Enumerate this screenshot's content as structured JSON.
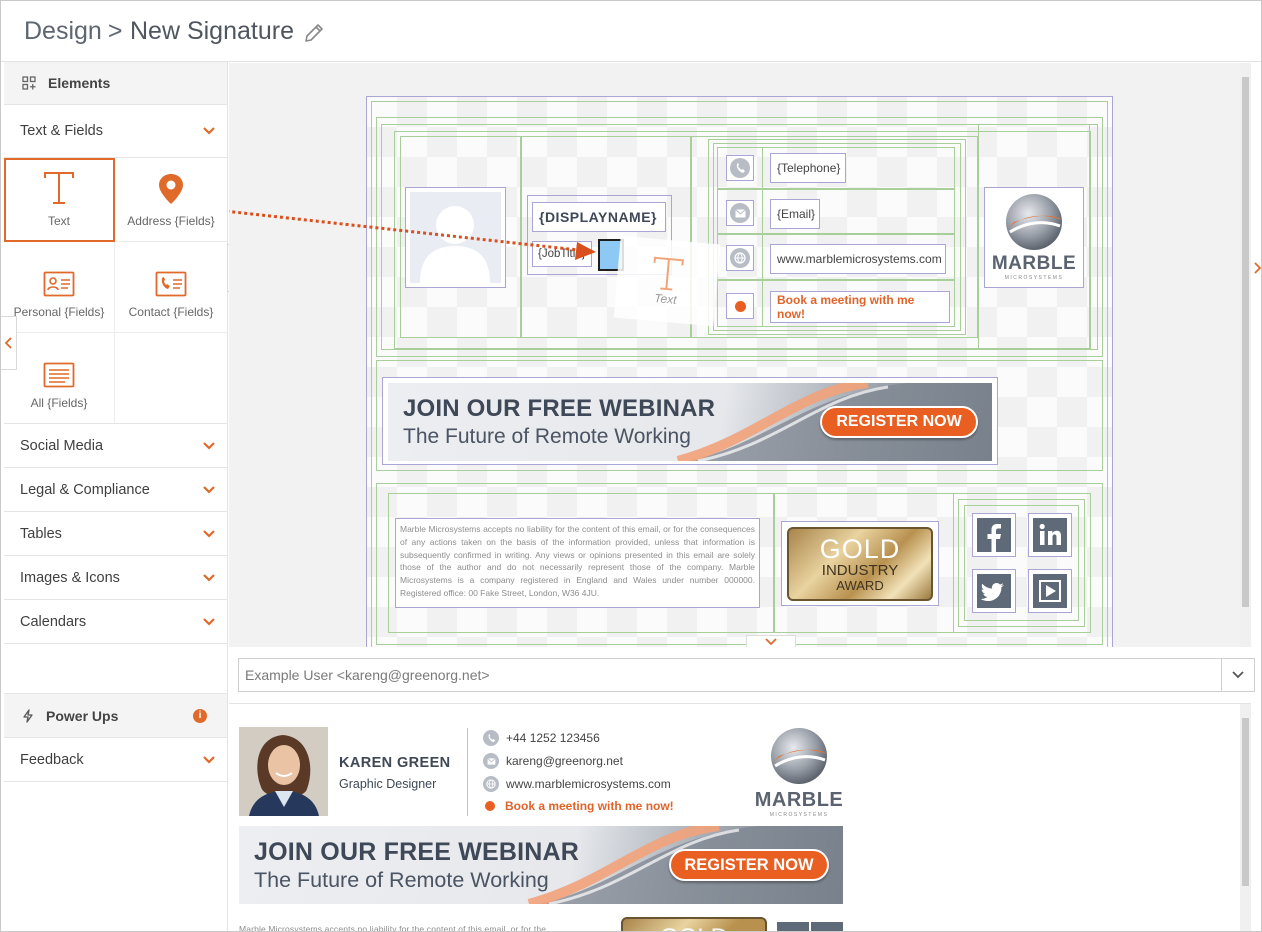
{
  "header": {
    "breadcrumb": "Design",
    "separator": ">",
    "title": "New Signature"
  },
  "sidebar": {
    "elements_header": "Elements",
    "text_fields_label": "Text & Fields",
    "tiles": [
      {
        "label": "Text",
        "icon": "text-icon"
      },
      {
        "label": "Address {Fields}",
        "icon": "map-pin-icon"
      },
      {
        "label": "Personal {Fields}",
        "icon": "id-card-icon"
      },
      {
        "label": "Contact {Fields}",
        "icon": "contact-card-icon"
      },
      {
        "label": "All {Fields}",
        "icon": "all-fields-icon"
      }
    ],
    "accordions": [
      "Social Media",
      "Legal & Compliance",
      "Tables",
      "Images & Icons",
      "Calendars"
    ],
    "power_ups": "Power Ups",
    "feedback": "Feedback"
  },
  "editor": {
    "display_name": "{DISPLAYNAME}",
    "job_title": "{JobTitle}",
    "drag_ghost_label": "Text",
    "telephone": "{Telephone}",
    "email": "{Email}",
    "website": "www.marblemicrosystems.com",
    "meeting": "Book a meeting with me now!",
    "logo_name": "MARBLE",
    "logo_sub": "MICROSYSTEMS",
    "banner_line1": "JOIN OUR FREE WEBINAR",
    "banner_line2": "The Future of Remote Working",
    "banner_button": "REGISTER NOW",
    "disclaimer": "Marble Microsystems accepts no liability for the content of this email, or for the consequences of any actions taken on the basis of the information provided, unless that information is subsequently confirmed in writing. Any views or opinions presented in this email are solely those of the author and do not necessarily represent those of the company. Marble Microsystems is a company registered in England and Wales under number 000000. Registered office: 00 Fake Street, London, W36 4JU.",
    "award_line1": "GOLD",
    "award_line2": "INDUSTRY",
    "award_line3": "AWARD"
  },
  "from_user": "Example User <kareng@greenorg.net>",
  "preview": {
    "name": "KAREN GREEN",
    "title": "Graphic Designer",
    "phone": "+44 1252 123456",
    "email": "kareng@greenorg.net",
    "website": "www.marblemicrosystems.com",
    "meeting": "Book a meeting with me now!",
    "disclaimer_snippet": "Marble Microsystems accepts no liability for the content of this email, or for the",
    "award_snippet": "GOLD"
  },
  "colors": {
    "accent": "#e06a2a",
    "guide_green": "#a8cf9a",
    "guide_purple": "#a9a6d6",
    "banner_text": "#3e4856",
    "button": "#e85f21"
  }
}
